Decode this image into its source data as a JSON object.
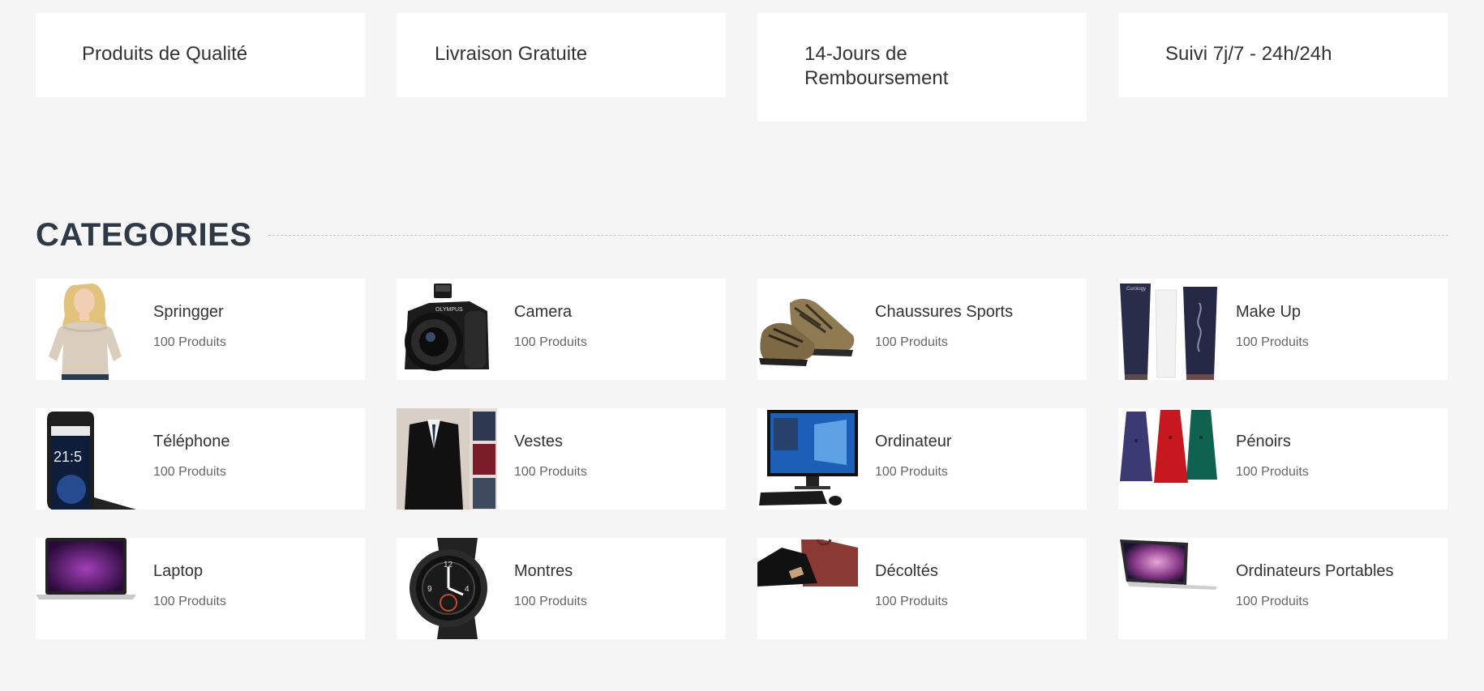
{
  "features": [
    {
      "text": "Produits de Qualité"
    },
    {
      "text": "Livraison Gratuite"
    },
    {
      "text": "14-Jours de Remboursement"
    },
    {
      "text": "Suivi 7j/7 - 24h/24h"
    }
  ],
  "categories_title": "CATEGORIES",
  "categories": [
    {
      "name": "Springger",
      "count": "100 Produits",
      "image": "woman-sweater-image"
    },
    {
      "name": "Camera",
      "count": "100 Produits",
      "image": "camera-image"
    },
    {
      "name": "Chaussures Sports",
      "count": "100 Produits",
      "image": "shoes-image"
    },
    {
      "name": "Make Up",
      "count": "100 Produits",
      "image": "makeup-tubes-image"
    },
    {
      "name": "Téléphone",
      "count": "100 Produits",
      "image": "smartphone-image"
    },
    {
      "name": "Vestes",
      "count": "100 Produits",
      "image": "suit-jacket-image"
    },
    {
      "name": "Ordinateur",
      "count": "100 Produits",
      "image": "desktop-monitor-image"
    },
    {
      "name": "Pénoirs",
      "count": "100 Produits",
      "image": "coats-image"
    },
    {
      "name": "Laptop",
      "count": "100 Produits",
      "image": "laptop-image"
    },
    {
      "name": "Montres",
      "count": "100 Produits",
      "image": "smartwatch-image"
    },
    {
      "name": "Décoltés",
      "count": "100 Produits",
      "image": "tshirts-image"
    },
    {
      "name": "Ordinateurs Portables",
      "count": "100 Produits",
      "image": "macbook-image"
    }
  ]
}
